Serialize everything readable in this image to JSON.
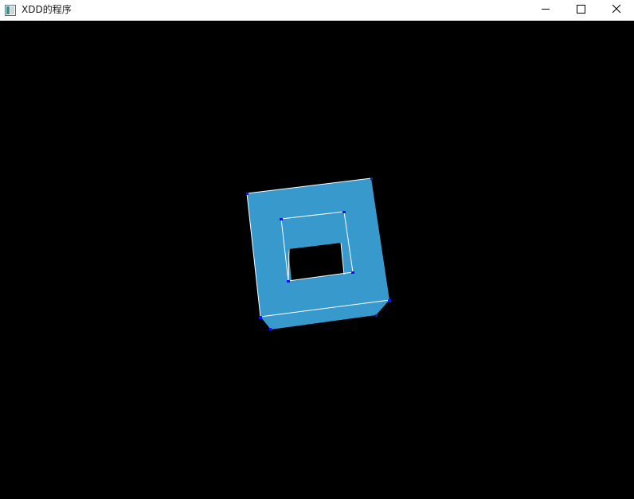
{
  "window": {
    "title": "XDD的程序",
    "app_icon": "window-app-icon",
    "buttons": {
      "minimize": "minimize-icon",
      "maximize": "maximize-icon",
      "close": "close-icon"
    }
  },
  "scene": {
    "background_color": "#000000",
    "object": "square-frame-with-hole",
    "face_color": "#3799cc",
    "edge_color": "#ffffff",
    "vertex_color": "#1010ff"
  }
}
